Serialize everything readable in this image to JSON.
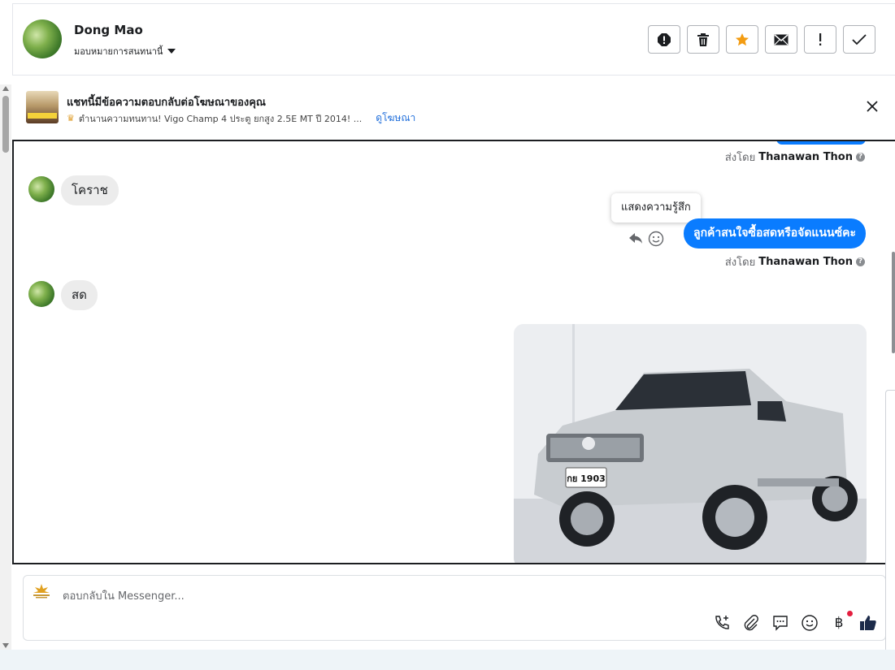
{
  "header": {
    "name": "Dong Mao",
    "assign_label": "มอบหมายการสนทนานี้"
  },
  "actions": [
    {
      "name": "report-icon"
    },
    {
      "name": "trash-icon"
    },
    {
      "name": "star-icon",
      "color": "#f39c12"
    },
    {
      "name": "envelope-icon"
    },
    {
      "name": "exclamation-icon"
    },
    {
      "name": "check-icon"
    }
  ],
  "ad_banner": {
    "title": "แชทนี้มีข้อความตอบกลับต่อโฆษณาของคุณ",
    "description": "ตำนานความทนทาน! Vigo Champ 4 ประตู ยกสูง 2.5E MT ปี 2014! ...",
    "link": "ดูโฆษณา"
  },
  "messages": {
    "sent_by_prefix": "ส่งโดย",
    "sent_by_name": "Thanawan Thon",
    "incoming_1": "โคราช",
    "outgoing_1": "ลูกค้าสนใจซื้อสดหรือจัดแนนซ์คะ",
    "incoming_2": "สด",
    "tooltip": "แสดงความรู้สึก",
    "plate_text": "กย 1903"
  },
  "composer": {
    "placeholder": "ตอบกลับใน Messenger..."
  },
  "colors": {
    "messenger_blue": "#0a7cff",
    "link_blue": "#216fdb",
    "incoming_bubble": "#ececec",
    "thumb_navy": "#1c2b4a"
  }
}
